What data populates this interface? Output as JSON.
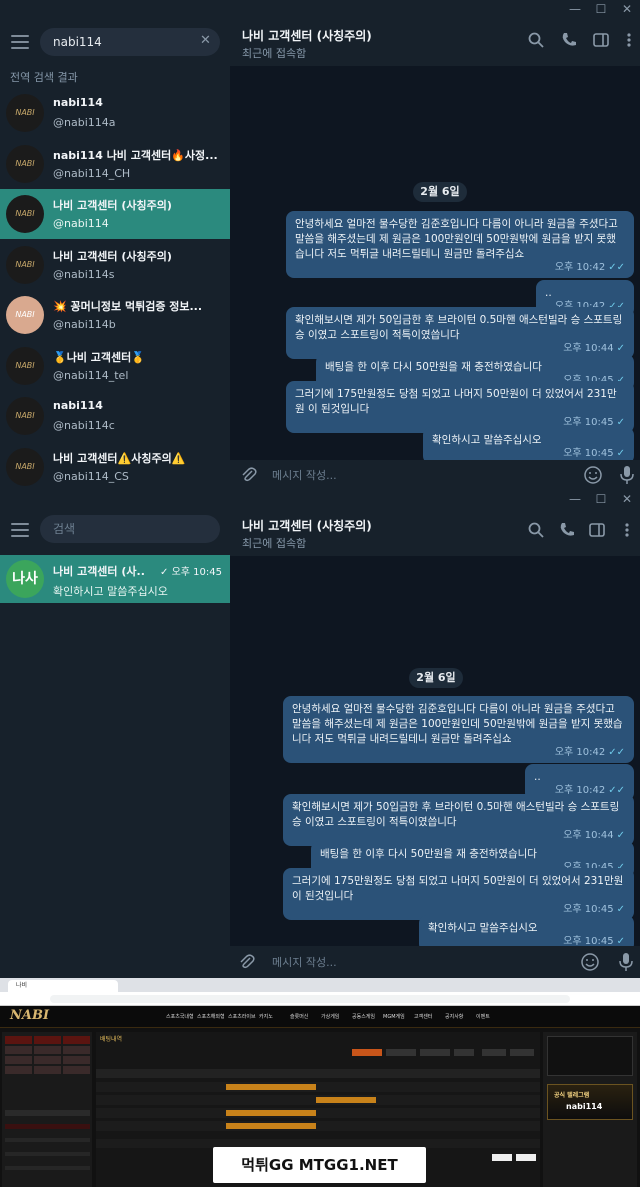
{
  "window1": {
    "search_value": "nabi114",
    "section_title": "전역 검색 결과",
    "results": [
      {
        "name": "nabi114",
        "username": "@nabi114a"
      },
      {
        "name": "nabi114 나비 고객센터🔥사정...",
        "username": "@nabi114_CH"
      },
      {
        "name": "나비 고객센터 (사칭주의)",
        "username": "@nabi114"
      },
      {
        "name": "나비 고객센터 (사칭주의)",
        "username": "@nabi114s"
      },
      {
        "name": "💥 꽁머니정보 먹튀검증 정보...",
        "username": "@nabi114b"
      },
      {
        "name": "🥇나비 고객센터🥇",
        "username": "@nabi114_tel"
      },
      {
        "name": "nabi114",
        "username": "@nabi114c"
      },
      {
        "name": "나비 고객센터⚠️사칭주의⚠️",
        "username": "@nabi114_CS"
      }
    ],
    "chat_title": "나비 고객센터 (사칭주의)",
    "chat_status": "최근에 접속함",
    "date": "2월 6일",
    "messages": [
      {
        "text": "안녕하세요 얼마전 물수당한 김준호입니다 다름이 아니라 원금을 주셨다고 말씀을 해주셨는데 제 원금은 100만원인데 50만원밖에 원금을 받지 못했습니다 저도 먹튀글 내려드릴테니 원금만 돌려주십쇼",
        "time": "오후 10:42"
      },
      {
        "text": "..",
        "time": "오후 10:42"
      },
      {
        "text": "확인해보시면 제가 50입금한 후 브라이턴 0.5마핸 애스턴빌라 승 스포트링 승 이였고 스포트링이 적특이였씁니다",
        "time": "오후 10:44"
      },
      {
        "text": "배팅을 한 이후 다시 50만원을 재 충전하였습니다",
        "time": "오후 10:45"
      },
      {
        "text": "그러기에 175만원정도 당첨 되었고 나머지 50만원이 더 있었어서 231만원 이 된것입니다",
        "time": "오후 10:45"
      },
      {
        "text": "확인하시고 말씀주십시오",
        "time": "오후 10:45"
      }
    ],
    "composer_placeholder": "메시지 작성..."
  },
  "window2": {
    "search_placeholder": "검색",
    "chat_list": [
      {
        "avatar": "나사",
        "name": "나비 고객센터 (사...",
        "time": "오후 10:45",
        "preview": "확인하시고 말씀주십시오"
      }
    ],
    "chat_title": "나비 고객센터 (사칭주의)",
    "chat_status": "최근에 접속함",
    "date": "2월 6일",
    "messages": [
      {
        "text": "안녕하세요 얼마전 물수당한 김준호입니다 다름이 아니라 원금을 주셨다고 말씀을 해주셨는데 제 원금은 100만원인데 50만원밖에 원금을 받지 못했습니다 저도 먹튀글 내려드릴테니 원금만 돌려주십쇼",
        "time": "오후 10:42"
      },
      {
        "text": "..",
        "time": "오후 10:42"
      },
      {
        "text": "확인해보시면 제가 50입금한 후 브라이턴 0.5마핸 애스턴빌라 승 스포트링 승 이였고 스포트링이 적특이였씁니다",
        "time": "오후 10:44"
      },
      {
        "text": "배팅을 한 이후 다시 50만원을 재 충전하였습니다",
        "time": "오후 10:45"
      },
      {
        "text": "그러기에 175만원정도 당첨 되었고 나머지 50만원이 더 있었어서 231만원 이 된것입니다",
        "time": "오후 10:45"
      },
      {
        "text": "확인하시고 말씀주십시오",
        "time": "오후 10:45"
      }
    ],
    "composer_placeholder": "메시지 작성..."
  },
  "website": {
    "tab_title": "나비",
    "logo": "NABI",
    "nav": [
      "스포츠국내형",
      "스포츠해외형",
      "스포츠라이브",
      "카지노",
      "슬롯머신",
      "가상게임",
      "공동스게임",
      "MGM게임",
      "고객센터",
      "공지사항",
      "이벤트"
    ],
    "section": "배팅내역",
    "promo_title": "공식 텔레그램",
    "promo_handle": "nabi114"
  },
  "watermark": "먹튀GG MTGG1.NET",
  "colors": {
    "selected": "#2b8a7e",
    "bubble": "#2b5278",
    "panel": "#17212b",
    "background": "#0e1621"
  }
}
